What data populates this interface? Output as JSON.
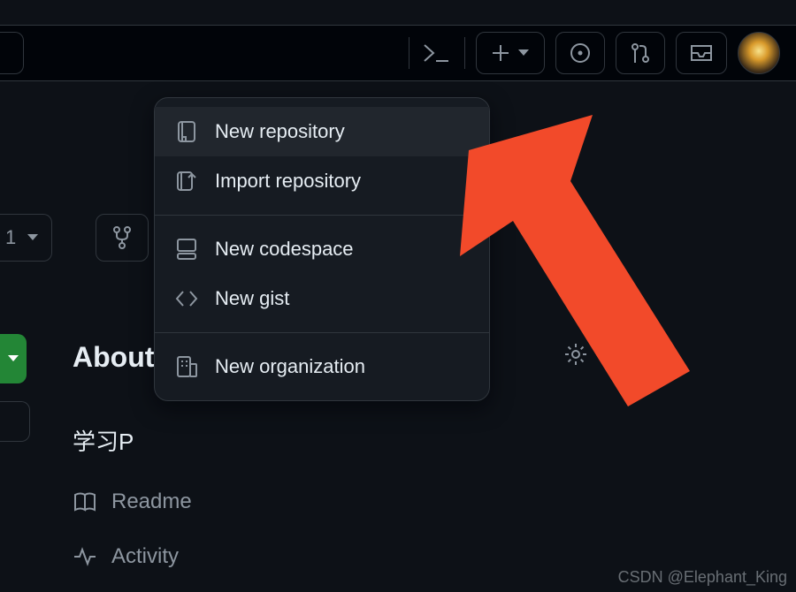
{
  "colors": {
    "bg": "#0d1117",
    "panel": "#161b22",
    "border": "#30363d",
    "muted": "#8d96a0",
    "text": "#e6edf3",
    "accent_green": "#238636",
    "arrow": "#f24a2a"
  },
  "topbar": {
    "command_icon": "command-line-icon",
    "plus_icon": "plus-icon",
    "caret_icon": "triangle-down-icon",
    "issues_icon": "issues-circle-icon",
    "pull_requests_icon": "git-pull-request-icon",
    "inbox_icon": "inbox-icon",
    "avatar_alt": "user-avatar"
  },
  "dropdown": {
    "items": [
      {
        "icon": "repo-icon",
        "label": "New repository",
        "highlight": true
      },
      {
        "icon": "repo-push-icon",
        "label": "Import repository",
        "highlight": false
      }
    ],
    "group2": [
      {
        "icon": "codespaces-icon",
        "label": "New codespace"
      },
      {
        "icon": "code-icon",
        "label": "New gist"
      }
    ],
    "group3": [
      {
        "icon": "organization-icon",
        "label": "New organization"
      }
    ]
  },
  "left": {
    "badge_value": "1",
    "fork_icon": "git-fork-icon",
    "about_heading": "About",
    "description": "学习P",
    "readme_label": "Readme",
    "activity_label": "Activity",
    "gear_icon": "gear-icon"
  },
  "watermark": "CSDN @Elephant_King"
}
